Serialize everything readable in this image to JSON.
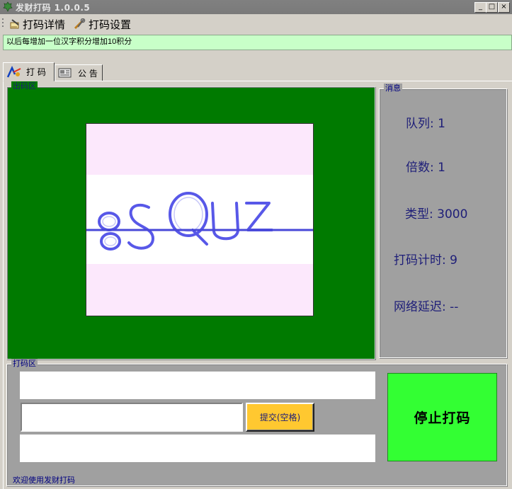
{
  "window": {
    "title": "发财打码 1.0.0.5",
    "minimize": "_",
    "maximize": "□",
    "close": "×"
  },
  "menu": {
    "details": "打码详情",
    "settings": "打码设置"
  },
  "notice": "以后每增加一位汉字积分增加10积分",
  "tabs": [
    {
      "label": "打 码"
    },
    {
      "label": "公 告"
    }
  ],
  "output_area": {
    "label": "出码区",
    "captcha_text": "8SQUZ"
  },
  "messages": {
    "label": "消息",
    "queue": "队列: 1",
    "multiplier": "倍数: 1",
    "type": "类型: 3000",
    "timer": "打码计时: 9",
    "latency": "网络延迟: --"
  },
  "input_area": {
    "label": "打码区",
    "input_value": "",
    "submit_label": "提交(空格)",
    "stop_label": "停止打码",
    "status": "欢迎使用发财打码"
  },
  "colors": {
    "output_bg": "#007a00",
    "stop_button": "#33ff33",
    "submit_button": "#ffc830",
    "notice_bg": "#c8ffc8"
  }
}
